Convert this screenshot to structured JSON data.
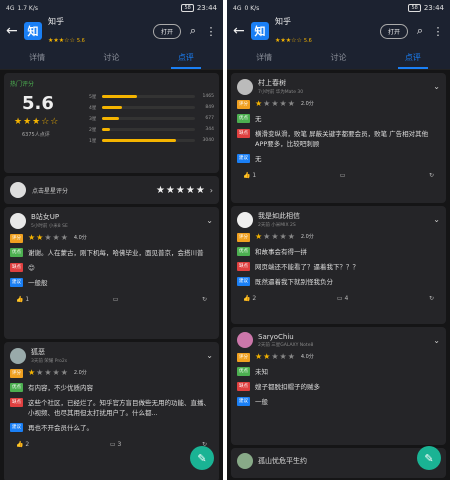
{
  "status": {
    "left_signal": "4G",
    "left_speed": "1.7 K/s",
    "right_signal": "4G",
    "right_speed": "0 K/s",
    "battery": "58",
    "time": "23:44"
  },
  "app": {
    "logo_char": "知",
    "title": "知乎",
    "rating_stars": "★★★☆☆",
    "rating_value": "5.6",
    "open_label": "打开"
  },
  "tabs": [
    "详情",
    "讨论",
    "点评"
  ],
  "summary": {
    "header": "热门评分",
    "score": "5.6",
    "stars": "★★★☆☆",
    "count": "6375人点评",
    "bars": [
      {
        "label": "5星",
        "value": "1465",
        "fraction": 0.38
      },
      {
        "label": "4星",
        "value": "849",
        "fraction": 0.22
      },
      {
        "label": "3星",
        "value": "677",
        "fraction": 0.18
      },
      {
        "label": "2星",
        "value": "344",
        "fraction": 0.09
      },
      {
        "label": "1星",
        "value": "3040",
        "fraction": 0.8
      }
    ]
  },
  "rate_prompt": {
    "text": "点击星星评分",
    "stars": "★★★★★"
  },
  "left_reviews": [
    {
      "name": "B站女UP",
      "meta": "5小时前  小米8 SE",
      "score_label": "评分",
      "stars_on": "★★",
      "stars_off": "★★★",
      "score": "4.0分",
      "lines": [
        {
          "badge": "优点",
          "type": "pro",
          "text": "谢谢。人在蒙古，刚下机每，哈佛毕业，面见普京，会搭川普"
        },
        {
          "badge": "缺点",
          "type": "con",
          "text": "😊"
        },
        {
          "badge": "建议",
          "type": "sug",
          "text": "一般般"
        }
      ],
      "likes": "1",
      "comments": ""
    },
    {
      "name": "狐恶",
      "meta": "3天前  荣耀 Pro2s",
      "score_label": "评分",
      "stars_on": "★",
      "stars_off": "★★★★",
      "score": "2.0分",
      "lines": [
        {
          "badge": "优点",
          "type": "pro",
          "text": "有内容，不少优质内容"
        },
        {
          "badge": "缺点",
          "type": "con",
          "text": "这些个社区，已经烂了。知乎官方盲目做些无用的功能、直播、小视频、也尽其用但太打扰用户了。什么都..."
        },
        {
          "badge": "建议",
          "type": "sug",
          "text": "再也不开会员什么了。"
        }
      ],
      "likes": "2",
      "comments": "3"
    }
  ],
  "right_reviews": [
    {
      "name": "村上春树",
      "meta": "7小时前  华为Mate 30",
      "score_label": "评分",
      "stars_on": "★",
      "stars_off": "★★★★",
      "score": "2.0分",
      "lines": [
        {
          "badge": "优点",
          "type": "pro",
          "text": "无"
        },
        {
          "badge": "缺点",
          "type": "con",
          "text": "横滑变纵滑，败笔 屏蔽关键字都要会员，败笔 广告相对其他APP要多，比较吧刺顾"
        },
        {
          "badge": "建议",
          "type": "sug",
          "text": "无"
        }
      ],
      "likes": "1",
      "comments": ""
    },
    {
      "name": "我是如此相信",
      "meta": "2天前  小米MIX 2S",
      "score_label": "评分",
      "stars_on": "★",
      "stars_off": "★★★★",
      "score": "2.0分",
      "lines": [
        {
          "badge": "优点",
          "type": "pro",
          "text": "和故事会有得一拼"
        },
        {
          "badge": "缺点",
          "type": "con",
          "text": "网页端还不能看了？逼着我下？？？"
        },
        {
          "badge": "建议",
          "type": "sug",
          "text": "既然逼着我下就别怪我负分"
        }
      ],
      "likes": "2",
      "comments": "4"
    },
    {
      "name": "SaryoChiu",
      "meta": "2天前  三星GALAXY Note8",
      "score_label": "评分",
      "stars_on": "★★",
      "stars_off": "★★★",
      "score": "4.0分",
      "lines": [
        {
          "badge": "优点",
          "type": "pro",
          "text": "未知"
        },
        {
          "badge": "缺点",
          "type": "con",
          "text": "嫂子都脱扣帽子的贼多"
        },
        {
          "badge": "建议",
          "type": "sug",
          "text": "一般"
        }
      ],
      "likes": "",
      "comments": ""
    },
    {
      "name": "孤山忧危平生约",
      "meta": "",
      "score_label": "",
      "stars_on": "",
      "stars_off": "",
      "score": "",
      "lines": [],
      "likes": "",
      "comments": ""
    }
  ],
  "icons": {
    "back": "back-arrow-icon",
    "search": "search-icon",
    "more": "more-vert-icon",
    "like": "thumb-up-icon",
    "comment": "comment-icon",
    "share": "share-icon",
    "fab": "edit-pencil-icon"
  },
  "colors": {
    "accent": "#1a7ff5",
    "star": "#f5b400",
    "fab": "#1ab394"
  }
}
